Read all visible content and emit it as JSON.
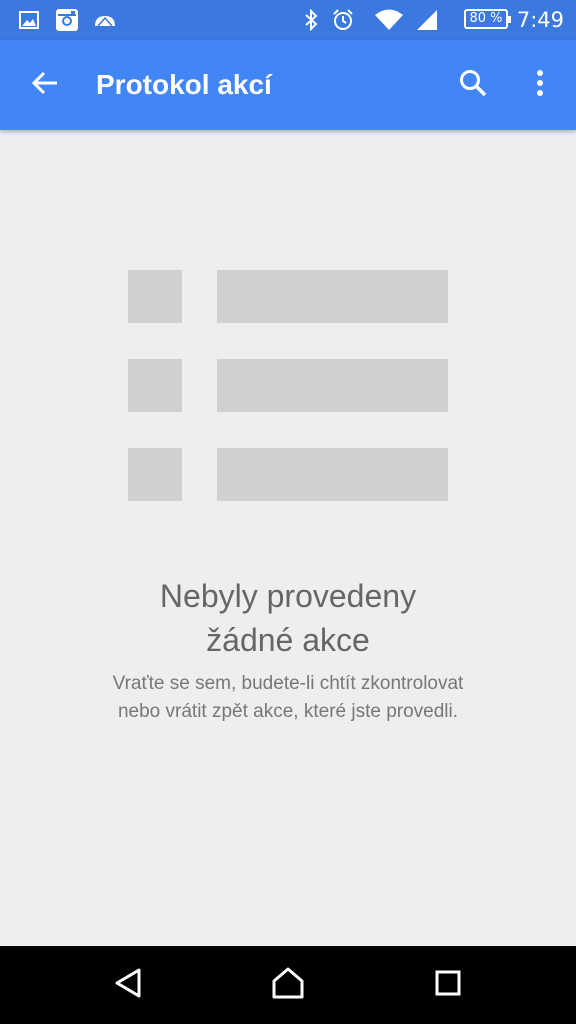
{
  "status_bar": {
    "time": "7:49",
    "battery": "80 %",
    "icons": [
      "gallery-icon",
      "instagram-icon",
      "cloud-icon",
      "bluetooth-icon",
      "alarm-icon",
      "wifi-icon",
      "signal-icon",
      "battery-icon"
    ]
  },
  "app_bar": {
    "title": "Protokol akcí",
    "back_icon": "arrow-back-icon",
    "search_icon": "search-icon",
    "menu_icon": "more-vert-icon",
    "color": "#4285f4"
  },
  "empty_state": {
    "title_line1": "Nebyly provedeny",
    "title_line2": "žádné akce",
    "subtitle_line1": "Vraťte se sem, budete-li chtít zkontrolovat",
    "subtitle_line2": "nebo vrátit zpět akce, které jste provedli.",
    "illustration_icon": "list-placeholder-icon"
  },
  "nav_bar": {
    "icons": [
      "back-triangle-icon",
      "home-icon",
      "recents-icon"
    ]
  }
}
